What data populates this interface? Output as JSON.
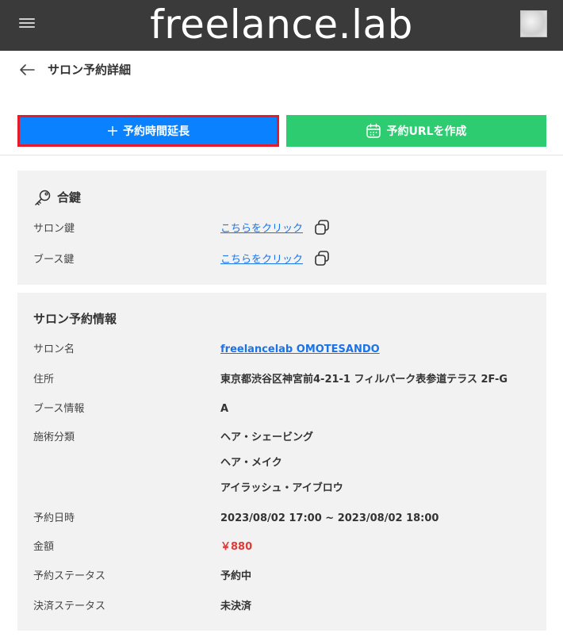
{
  "header": {
    "logo_text": "freelance.lab",
    "menu_icon": "hamburger-icon",
    "avatar_icon": "user-avatar"
  },
  "titlebar": {
    "back_icon": "arrow-left-icon",
    "title": "サロン予約詳細"
  },
  "actions": {
    "extend_label": "予約時間延長",
    "extend_icon": "plus-icon",
    "url_label": "予約URLを作成",
    "url_icon": "calendar-icon",
    "colors": {
      "extend": "#0a82ff",
      "extend_highlight": "#e21c2a",
      "url": "#2ecc71"
    }
  },
  "keys": {
    "heading": "合鍵",
    "heading_icon": "key-icon",
    "rows": [
      {
        "label": "サロン鍵",
        "link": "こちらをクリック",
        "icon": "copy-icon"
      },
      {
        "label": "ブース鍵",
        "link": "こちらをクリック",
        "icon": "copy-icon"
      }
    ]
  },
  "info": {
    "heading": "サロン予約情報",
    "salon_name_label": "サロン名",
    "salon_name": "freelancelab OMOTESANDO",
    "address_label": "住所",
    "address": "東京都渋谷区神宮前4-21-1 フィルパーク表参道テラス 2F-G",
    "booth_label": "ブース情報",
    "booth": "A",
    "treatment_label": "施術分類",
    "treatments": [
      "ヘア・シェービング",
      "ヘア・メイク",
      "アイラッシュ・アイブロウ"
    ],
    "datetime_label": "予約日時",
    "datetime": "2023/08/02 17:00 ~ 2023/08/02 18:00",
    "price_label": "金額",
    "price": "￥880",
    "price_color": "#e03a3a",
    "status_label": "予約ステータス",
    "status": "予約中",
    "payment_label": "決済ステータス",
    "payment": "未決済"
  }
}
